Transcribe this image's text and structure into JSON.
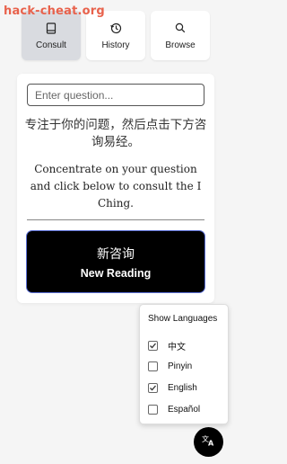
{
  "watermark": "hack-cheat.org",
  "tabs": [
    {
      "label": "Consult",
      "icon": "book-icon",
      "active": true
    },
    {
      "label": "History",
      "icon": "history-icon",
      "active": false
    },
    {
      "label": "Browse",
      "icon": "search-icon",
      "active": false
    }
  ],
  "question": {
    "placeholder": "Enter question...",
    "value": ""
  },
  "prompt": {
    "zh": "专注于你的问题，然后点击下方咨询易经。",
    "en": "Concentrate on your question and click below to consult the I Ching."
  },
  "new_reading": {
    "zh": "新咨询",
    "en": "New Reading"
  },
  "languages_menu": {
    "title": "Show Languages",
    "items": [
      {
        "label": "中文",
        "checked": true
      },
      {
        "label": "Pinyin",
        "checked": false
      },
      {
        "label": "English",
        "checked": true
      },
      {
        "label": "Español",
        "checked": false
      }
    ]
  },
  "fab": {
    "icon": "translate-icon"
  },
  "colors": {
    "accent": "#000000",
    "active_tab": "#d9dbe0",
    "watermark": "#e8624c"
  }
}
